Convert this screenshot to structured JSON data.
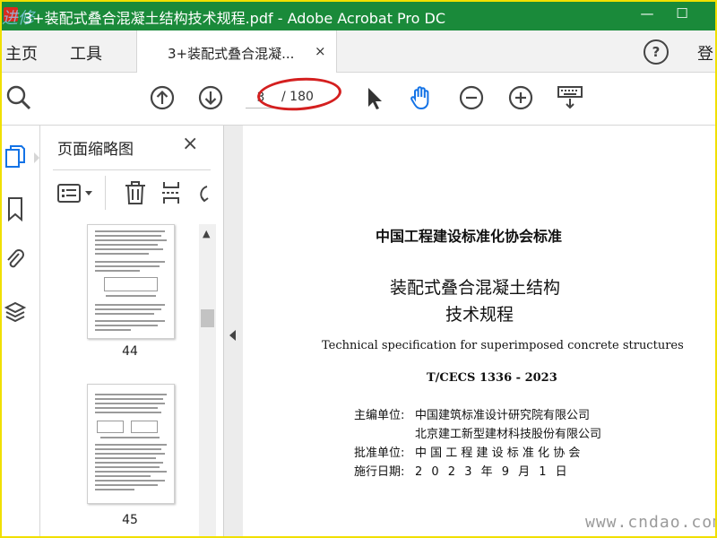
{
  "window": {
    "title": "3+装配式叠合混凝土结构技术规程.pdf - Adobe Acrobat Pro DC",
    "watermark": "进修",
    "controls": [
      "—",
      "☐"
    ]
  },
  "tabs": {
    "home": "主页",
    "tools": "工具",
    "document": "3+装配式叠合混凝...",
    "document_close": "×",
    "help": "?",
    "login": "登"
  },
  "toolbar": {
    "icons": [
      "zoom-icon",
      "page-up-icon",
      "page-down-icon",
      "select-arrow-icon",
      "hand-tool-icon",
      "zoom-out-icon",
      "zoom-in-icon",
      "keyboard-icon"
    ],
    "page_current": "3",
    "page_total": "/ 180"
  },
  "sidebar_rail": {
    "icons": [
      "pages-icon",
      "bookmark-icon",
      "attachment-icon",
      "layers-icon"
    ]
  },
  "thumbnail_panel": {
    "title": "页面缩略图",
    "close": "×",
    "thumbnails": [
      {
        "page": "44"
      },
      {
        "page": "45"
      }
    ]
  },
  "document": {
    "organization": "中国工程建设标准化协会标准",
    "title_line1": "装配式叠合混凝土结构",
    "title_line2": "技术规程",
    "english_title": "Technical specification for superimposed concrete structures",
    "code": "T/CECS 1336 - 2023",
    "info": [
      {
        "label": "主编单位:",
        "value": "中国建筑标准设计研究院有限公司"
      },
      {
        "label": "",
        "value": "北京建工新型建材科技股份有限公司"
      },
      {
        "label": "批准单位:",
        "value": "中 国 工 程 建 设 标 准 化 协 会"
      },
      {
        "label": "施行日期:",
        "value": "2 0 2 3 年 9 月 1 日"
      }
    ],
    "watermark": "www.cndao.com"
  },
  "colors": {
    "titlebar": "#1a8a3a",
    "hand_tool_active": "#1473e6",
    "annotation": "#d41f1f",
    "frame": "#f0e000"
  }
}
